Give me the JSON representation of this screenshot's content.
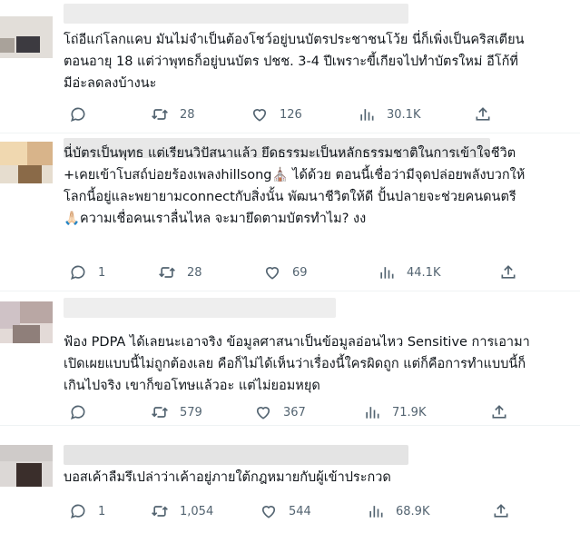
{
  "icons": {
    "reply": "speech-bubble-icon",
    "retweet": "retweet-arrows-icon",
    "like": "heart-icon",
    "views": "bar-chart-icon",
    "share": "upload-arrow-icon"
  },
  "colors": {
    "action_gray": "#536471",
    "text": "#0f1419",
    "divider": "#eff3f4"
  },
  "tweets": [
    {
      "text": "โถ่อีแก่โลกแคบ มันไม่จำเป็นต้องโชว์อยู่บนบัตรประชาชนโว้ย นี่ก็เพิ่งเป็นคริสเตียน\nตอนอายุ 18 แต่ว่าพุทธก็อยู่บนบัตร ปชช. 3-4 ปีเพราะขี้เกียจไปทำบัตรใหม่ อีโก้ที่\nมีอ่ะลดลงบ้างนะ",
      "replies": "",
      "retweets": "28",
      "likes": "126",
      "views": "30.1K"
    },
    {
      "text": "นี่บัตรเป็นพุทธ แต่เรียนวิปัสนาแล้ว ยึดธรรมะเป็นหลักธรรมชาติในการเข้าใจชีวิต\n+เคยเข้าโบสถ์บ่อยร้องเพลงhillsong⛪ ได้ด้วย ตอนนี้เชื่อว่ามีจุดปล่อยพลังบวกให้\nโลกนี้อยู่และพยายามconnectกับสิ่งนั้น พัฒนาชีวิตให้ดี ปั้นปลายจะช่วยคนดนตรี\n🙏🏻ความเชื่อคนเราลื่นไหล จะมายึดตามบัตรทำไม? งง",
      "replies": "1",
      "retweets": "28",
      "likes": "69",
      "views": "44.1K"
    },
    {
      "text": "ฟ้อง PDPA ได้เลยนะเอาจริง ข้อมูลศาสนาเป็นข้อมูลอ่อนไหว Sensitive การเอามา\nเปิดเผยแบบนี้ไม่ถูกต้องเลย คือก็ไม่ได้เห็นว่าเรื่องนี้ใครผิดถูก แต่ก็คือการทำแบบนี้ก็\nเกินไปจริง เขาก็ขอโทษแล้วอะ แต่ไม่ยอมหยุด",
      "replies": "",
      "retweets": "579",
      "likes": "367",
      "views": "71.9K"
    },
    {
      "text": "บอสเค้าลืมรึเปล่าว่าเค้าอยู่ภายใต้กฎหมายกับผู้เข้าประกวด",
      "replies": "1",
      "retweets": "1,054",
      "likes": "544",
      "views": "68.9K"
    }
  ]
}
